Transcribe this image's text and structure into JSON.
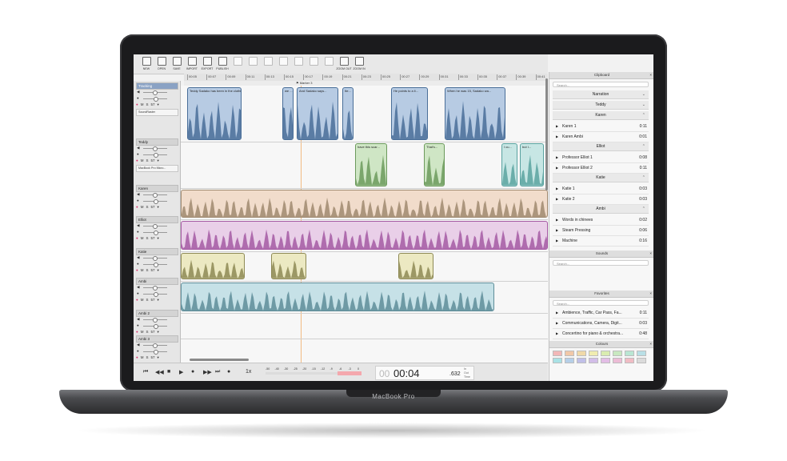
{
  "device": {
    "brand": "MacBook Pro"
  },
  "toolbar": [
    {
      "label": "NEW",
      "enabled": true
    },
    {
      "label": "OPEN",
      "enabled": true
    },
    {
      "label": "SAVE",
      "enabled": true
    },
    {
      "label": "IMPORT",
      "enabled": true
    },
    {
      "label": "EXPORT",
      "enabled": true
    },
    {
      "label": "PUBLISH",
      "enabled": true
    },
    {
      "label": "",
      "enabled": false
    },
    {
      "label": "",
      "enabled": false
    },
    {
      "label": "",
      "enabled": false
    },
    {
      "label": "",
      "enabled": false
    },
    {
      "label": "",
      "enabled": false
    },
    {
      "label": "",
      "enabled": false
    },
    {
      "label": "",
      "enabled": false
    },
    {
      "label": "ZOOM OUT",
      "enabled": true
    },
    {
      "label": "ZOOM IN",
      "enabled": true
    }
  ],
  "ruler": {
    "ticks": [
      "00:05",
      "00:07",
      "00:09",
      "00:11",
      "00:13",
      "00:15",
      "00:17",
      "00:19",
      "00:21",
      "00:23",
      "00:25",
      "00:27",
      "00:29",
      "00:31",
      "00:33",
      "00:35",
      "00:37",
      "00:39",
      "00:41"
    ]
  },
  "marker": {
    "label": "Marker 3"
  },
  "tracks": [
    {
      "name": "Tracking",
      "active": true,
      "device": "SoundRaster",
      "clips": [
        {
          "label": "Teddy Sadako has been in the clothing busines...",
          "color": "#b7cbe3",
          "wave": "#4a6f99"
        },
        {
          "label": "we ...",
          "color": "#b7cbe3",
          "wave": "#4a6f99"
        },
        {
          "label": "And Sadako says...",
          "color": "#b7cbe3",
          "wave": "#4a6f99"
        },
        {
          "label": "Ite...",
          "color": "#b7cbe3",
          "wave": "#4a6f99"
        },
        {
          "label": "He points to a li...",
          "color": "#b7cbe3",
          "wave": "#4a6f99"
        },
        {
          "label": "When he was 15, Sadako wa...",
          "color": "#b7cbe3",
          "wave": "#4a6f99"
        }
      ]
    },
    {
      "name": "Teddy",
      "active": false,
      "device": "MacBook Pro Micro...",
      "clips": [
        {
          "label": "have this scar...",
          "color": "#cfe6c5",
          "wave": "#6c9a5c"
        },
        {
          "label": "That's...",
          "color": "#cfe6c5",
          "wave": "#6c9a5c"
        },
        {
          "label": "I cu...",
          "color": "#c7e6e4",
          "wave": "#5aa3a0"
        },
        {
          "label": "but I...",
          "color": "#c7e6e4",
          "wave": "#5aa3a0"
        }
      ]
    },
    {
      "name": "Karen",
      "active": false,
      "clips": [
        {
          "label": "",
          "color": "#f1dccb",
          "wave": "#a08a70"
        }
      ]
    },
    {
      "name": "Elliot",
      "active": false,
      "clips": [
        {
          "label": "",
          "color": "#e9cfe8",
          "wave": "#a55aa3"
        }
      ]
    },
    {
      "name": "Katie",
      "active": false,
      "clips": [
        {
          "label": "",
          "color": "#ece9c2",
          "wave": "#8e8a55"
        },
        {
          "label": "",
          "color": "#ece9c2",
          "wave": "#8e8a55"
        },
        {
          "label": "",
          "color": "#ece9c2",
          "wave": "#8e8a55"
        }
      ]
    },
    {
      "name": "Ambi",
      "active": false,
      "clips": [
        {
          "label": "",
          "color": "#c6e1e7",
          "wave": "#5e8d99"
        }
      ]
    },
    {
      "name": "Ambi 2",
      "active": false,
      "clips": []
    },
    {
      "name": "Ambi 3",
      "active": false,
      "clips": []
    }
  ],
  "transport": {
    "buttons": [
      "⏮",
      "◀◀",
      "■",
      "▶",
      "●",
      "▶▶",
      "⏭",
      "●"
    ],
    "speed": "1x",
    "meter_labels": [
      "-50",
      "-40",
      "-30",
      "-25",
      "-20",
      "-15",
      "-12",
      "-9",
      "-6",
      "-3",
      "0"
    ],
    "time_main": "00:04",
    "time_ms": ".632",
    "time_prefix": "00",
    "time_labels": [
      "In",
      "Out",
      "Time"
    ]
  },
  "clipboard": {
    "title": "Clipboard",
    "search_placeholder": "Search...",
    "categories": [
      {
        "name": "Narration",
        "open": false,
        "items": []
      },
      {
        "name": "Teddy",
        "open": false,
        "items": []
      },
      {
        "name": "Karen",
        "open": true,
        "items": [
          {
            "name": "Karen 1",
            "dur": "0:11"
          },
          {
            "name": "Karen Ambi",
            "dur": "0:01"
          }
        ]
      },
      {
        "name": "Elliot",
        "open": true,
        "items": [
          {
            "name": "Professor Elliot 1",
            "dur": "0:08"
          },
          {
            "name": "Professor Elliot 2",
            "dur": "0:11"
          }
        ]
      },
      {
        "name": "Katie",
        "open": true,
        "items": [
          {
            "name": "Katie 1",
            "dur": "0:03"
          },
          {
            "name": "Katie 2",
            "dur": "0:03"
          }
        ]
      },
      {
        "name": "Ambi",
        "open": true,
        "items": [
          {
            "name": "Words in chinees",
            "dur": "0:02"
          },
          {
            "name": "Steam Pressing",
            "dur": "0:06"
          },
          {
            "name": "Machine",
            "dur": "0:16"
          }
        ]
      }
    ]
  },
  "sounds": {
    "title": "Sounds",
    "search_placeholder": "Search..."
  },
  "favorites": {
    "title": "Favorites",
    "search_placeholder": "Search...",
    "items": [
      {
        "name": "Ambience, Traffic, Car Pass, Fa...",
        "dur": "0:11"
      },
      {
        "name": "Communications, Camera, Digit...",
        "dur": "0:03"
      },
      {
        "name": "Concertino for piano & orchestra...",
        "dur": "0:48"
      }
    ]
  },
  "colours": {
    "title": "Colours",
    "swatches": [
      "#f2b7b7",
      "#f1c8a8",
      "#f0d9a8",
      "#f0ecb0",
      "#d9ecb0",
      "#c8e8c0",
      "#b9e6d3",
      "#b9dfe6",
      "#a9e2e6",
      "#b5cfe8",
      "#c0bfe8",
      "#d2bde8",
      "#e3bde6",
      "#ecbcd6",
      "#f0bcc4",
      "#dadada"
    ]
  }
}
